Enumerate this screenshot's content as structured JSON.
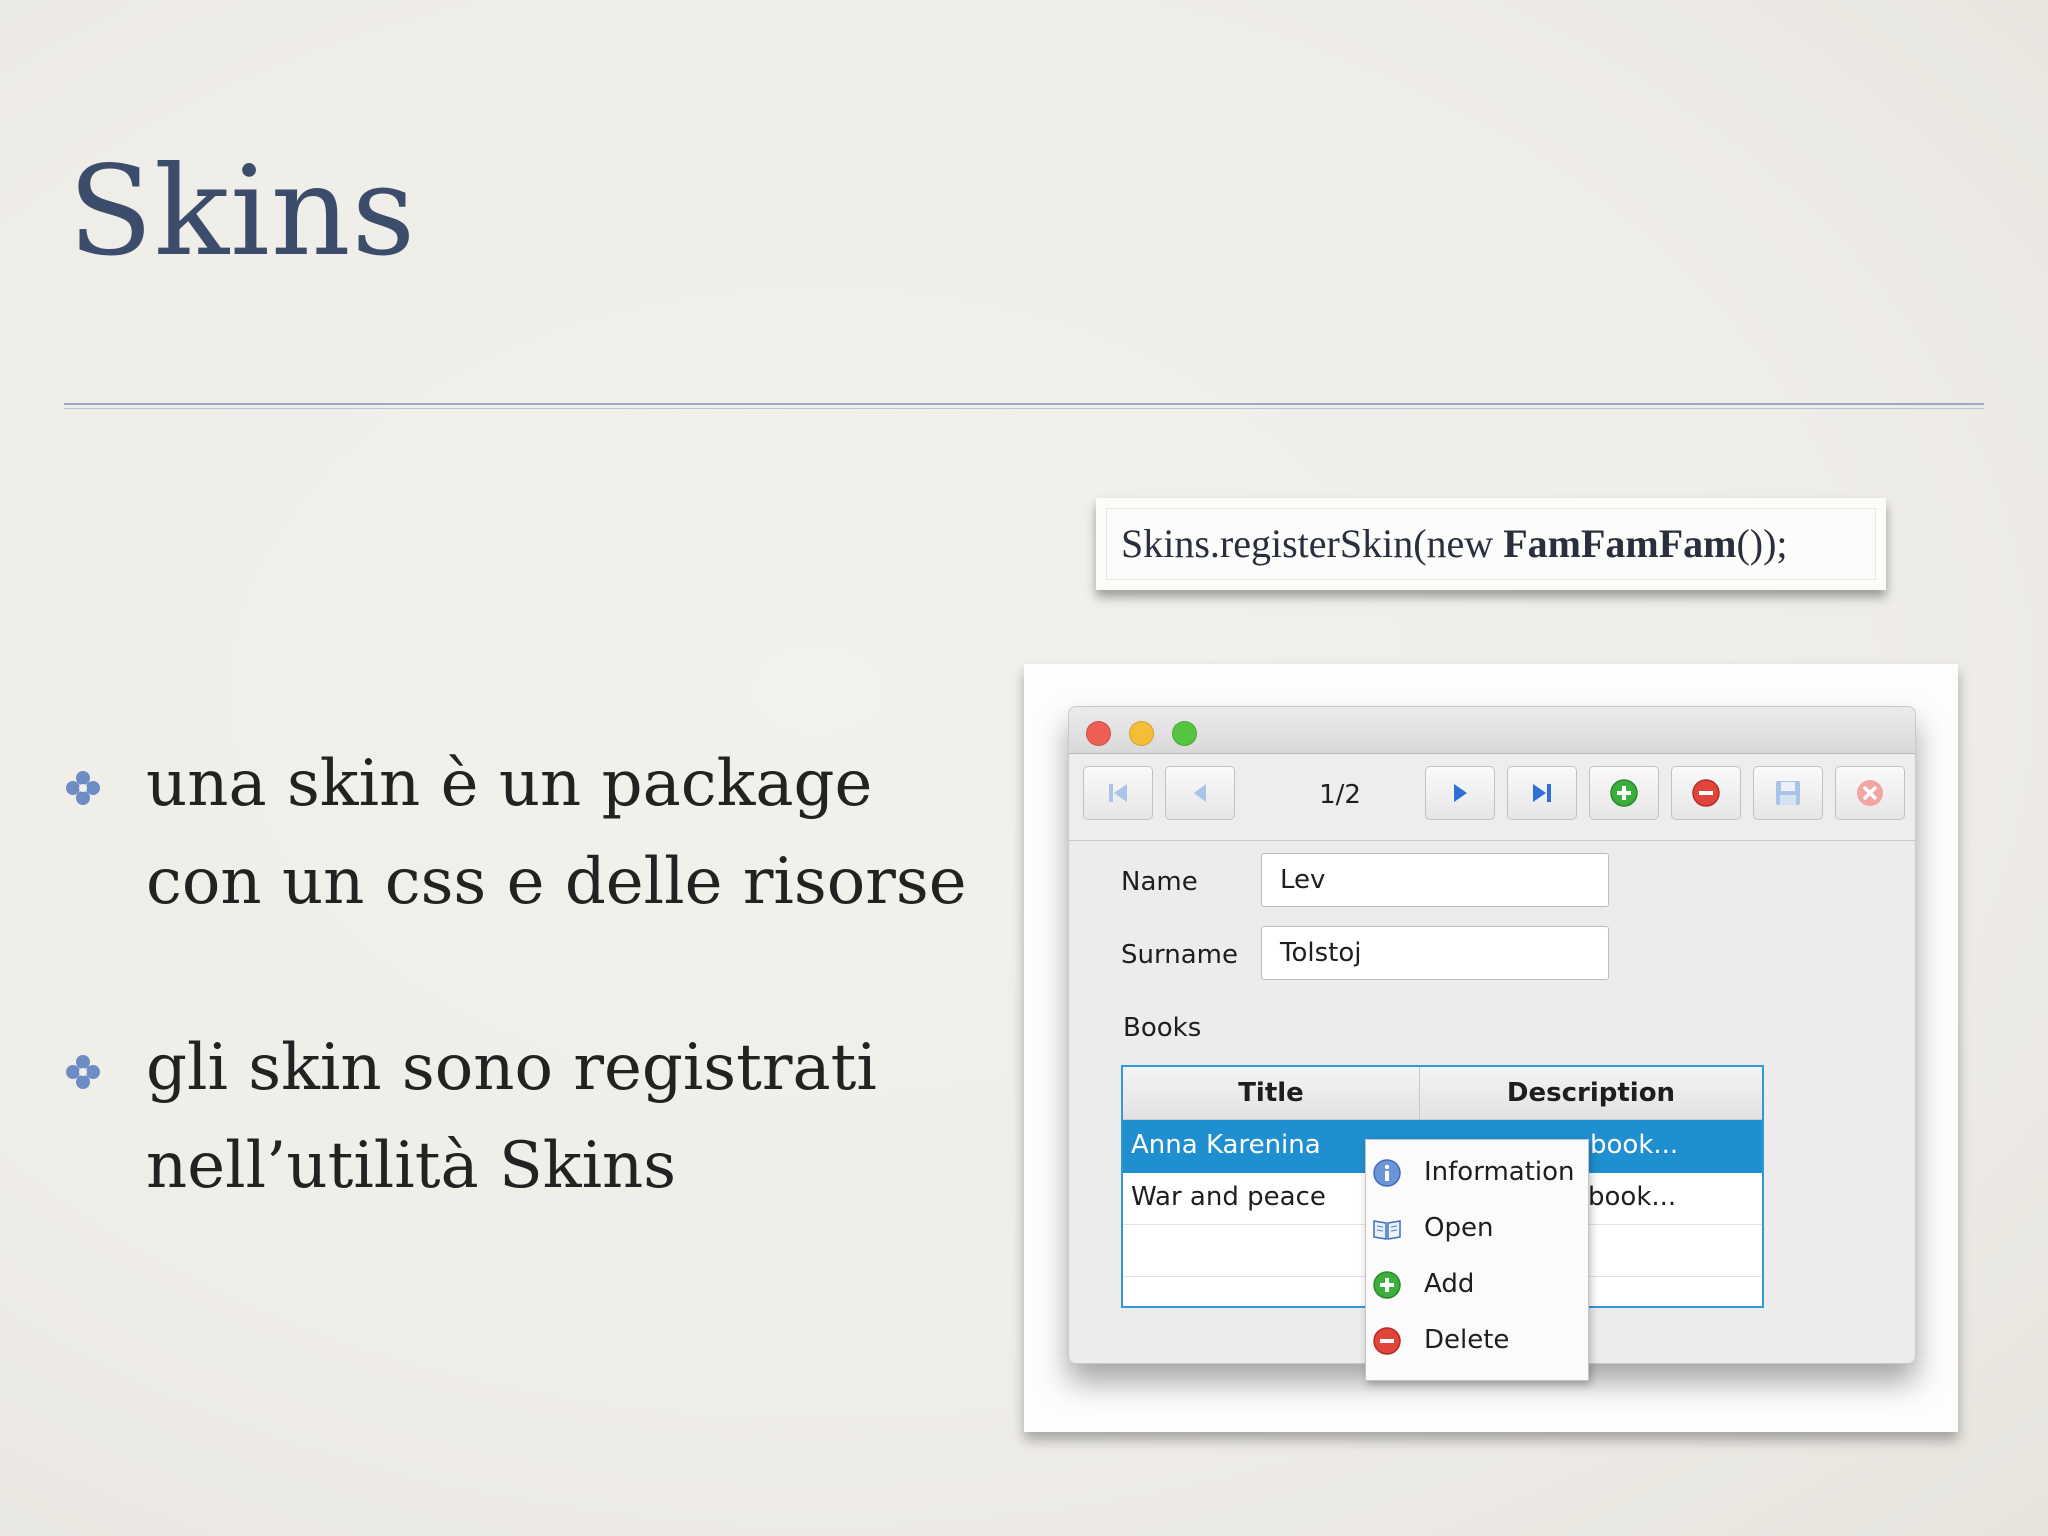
{
  "slide": {
    "title": "Skins",
    "bullets": [
      [
        "una skin è un package",
        "con un css e delle risorse"
      ],
      [
        "gli skin sono registrati",
        "nell’utilità Skins"
      ]
    ]
  },
  "code": {
    "prefix": "Skins.registerSkin(new ",
    "class_name": "FamFamFam",
    "suffix": "());"
  },
  "app_window": {
    "traffic_lights": {
      "close": "#ee5e55",
      "minimize": "#f4be36",
      "zoom": "#55c541"
    },
    "toolbar": {
      "page_indicator": "1/2",
      "buttons": [
        "first-icon",
        "previous-icon",
        "next-icon",
        "last-icon",
        "add-icon",
        "remove-icon",
        "save-icon",
        "close-icon"
      ]
    },
    "form": {
      "name_label": "Name",
      "name_value": "Lev",
      "surname_label": "Surname",
      "surname_value": "Tolstoj",
      "books_label": "Books"
    },
    "table": {
      "columns": [
        "Title",
        "Description"
      ],
      "rows": [
        {
          "title": "Anna Karenina",
          "description": "book...",
          "selected": true
        },
        {
          "title": "War and peace",
          "description": "book...",
          "selected": false
        }
      ],
      "accent": "#1f8fd0"
    },
    "context_menu": {
      "items": [
        {
          "label": "Information",
          "icon": "information-icon"
        },
        {
          "label": "Open",
          "icon": "book-open-icon"
        },
        {
          "label": "Add",
          "icon": "add-icon"
        },
        {
          "label": "Delete",
          "icon": "delete-icon"
        }
      ]
    }
  }
}
